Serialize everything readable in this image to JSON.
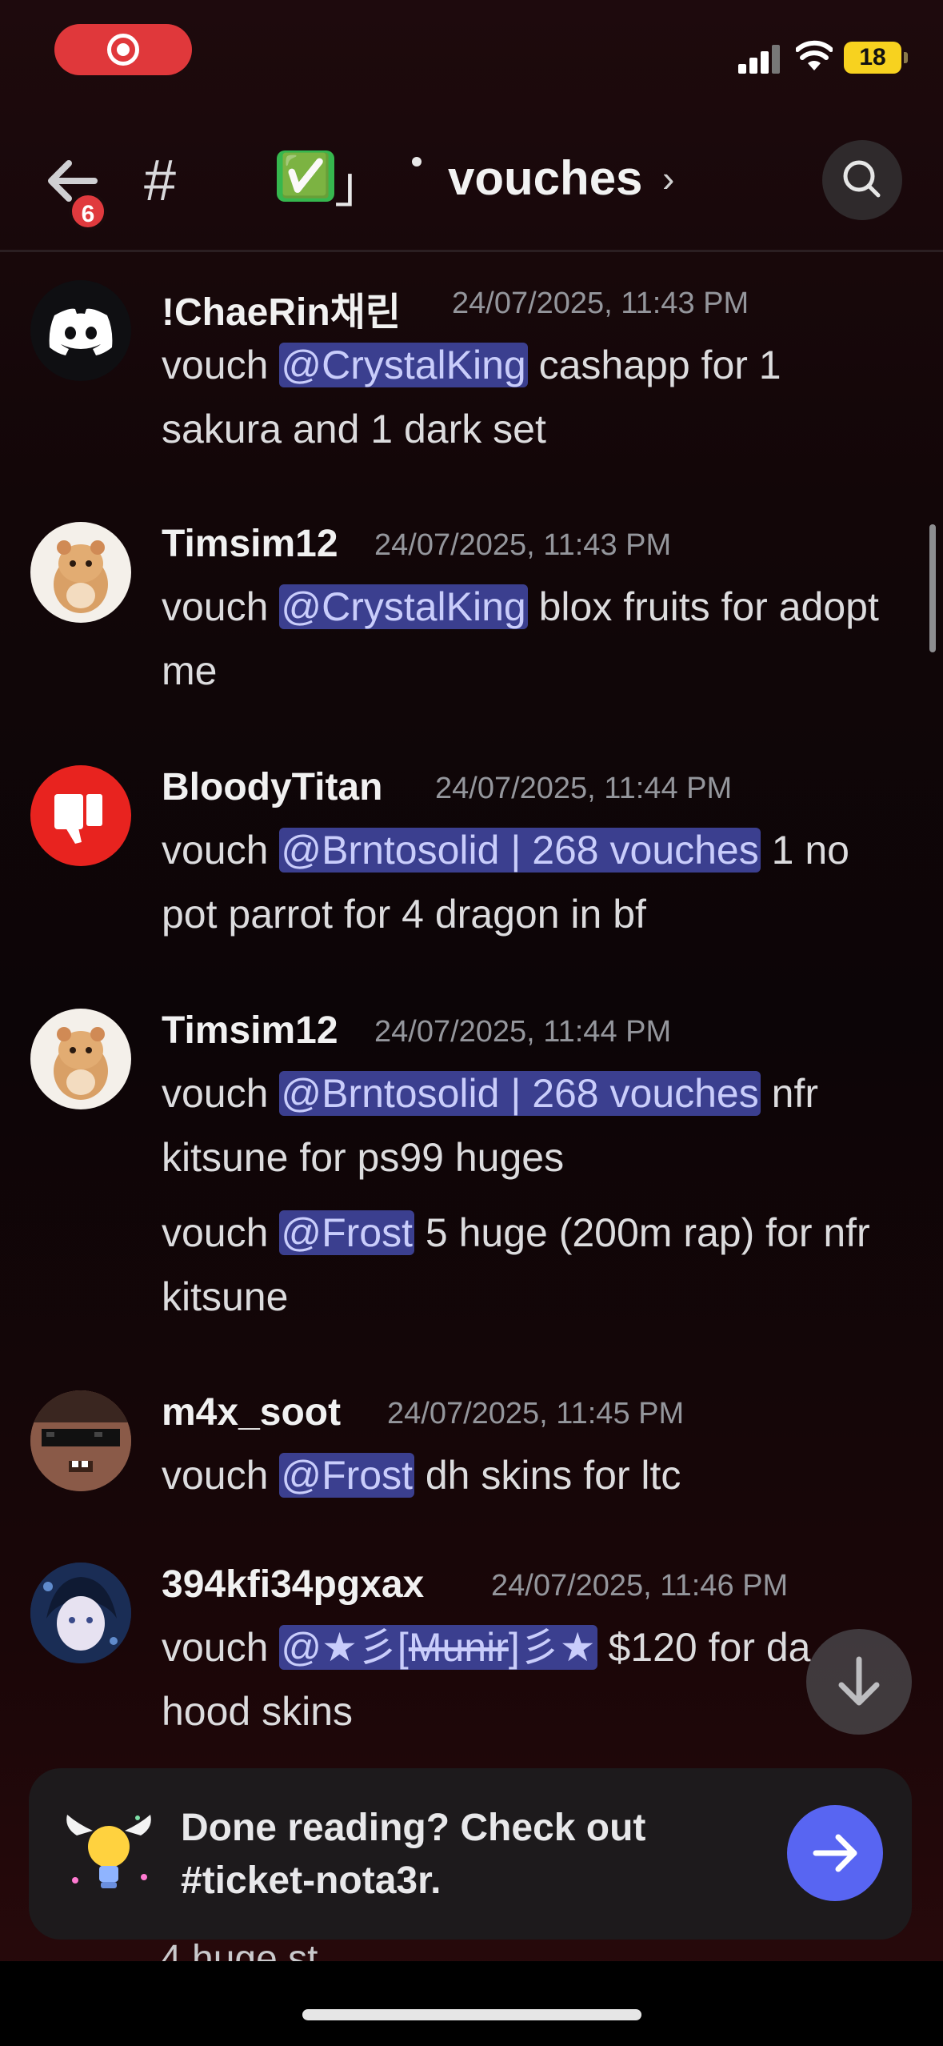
{
  "status_bar": {
    "battery": "18"
  },
  "header": {
    "badge_count": "6",
    "hash": "#",
    "channel_prefix_open": "「",
    "channel_emoji": "✅",
    "channel_prefix_close": "」",
    "channel_name": "vouches",
    "chevron": "›"
  },
  "messages": [
    {
      "user": "!ChaeRin채린",
      "time": "24/07/2025, 11:43 PM",
      "pre": "vouch ",
      "mention": "@CrystalKing",
      "post": " cashapp for 1 sakura and 1 dark set",
      "avatar": "discord-logo-avatar"
    },
    {
      "user": "Timsim12",
      "time": "24/07/2025, 11:43 PM",
      "pre": "vouch ",
      "mention": "@CrystalKing",
      "post": " blox fruits for adopt me",
      "avatar": "hamster-avatar"
    },
    {
      "user": "BloodyTitan",
      "time": "24/07/2025, 11:44 PM",
      "pre": "vouch ",
      "mention": "@Brntosolid | 268 vouches",
      "post": " 1 no pot parrot for 4 dragon in bf",
      "avatar": "thumbs-down-avatar"
    },
    {
      "user": "Timsim12",
      "time": "24/07/2025, 11:44 PM",
      "pre": "vouch ",
      "mention": "@Brntosolid | 268 vouches",
      "post": " nfr kitsune for ps99 huges",
      "avatar": "hamster-avatar"
    },
    {
      "user": "",
      "time": "",
      "pre": "vouch ",
      "mention": "@Frost",
      "post": " 5 huge (200m rap) for nfr kitsune",
      "avatar": ""
    },
    {
      "user": "m4x_soot",
      "time": "24/07/2025, 11:45 PM",
      "pre": "vouch ",
      "mention": "@Frost",
      "post": " dh skins for ltc",
      "avatar": "sunglasses-avatar"
    },
    {
      "user": "394kfi34pgxax",
      "time": "24/07/2025, 11:46 PM",
      "pre": "vouch ",
      "mention_a": "@★彡[",
      "mention_strike": "Munir",
      "mention_b": "]彡★",
      "post": " $120 for da hood skins",
      "avatar": "anime-avatar"
    }
  ],
  "banner": {
    "text": "Done reading? Check out #ticket-nota3r."
  },
  "bottom_peek": "4 huge st..."
}
